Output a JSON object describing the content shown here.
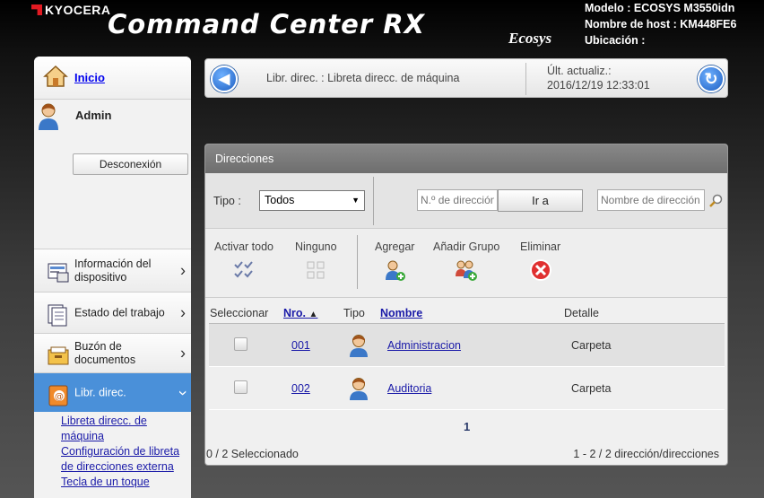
{
  "header": {
    "brand": "KYOCERA",
    "app_title": "Command Center RX",
    "ecosys": "Ecosys",
    "device_info": {
      "model": "Modelo : ECOSYS M3550idn",
      "host": "Nombre de host : KM448FE6",
      "location": "Ubicación :"
    }
  },
  "sidebar": {
    "home_label": "Inicio",
    "user_name": "Admin",
    "logout_label": "Desconexión",
    "items": [
      {
        "label": "Información del dispositivo",
        "icon": "device-info-icon"
      },
      {
        "label": "Estado del trabajo",
        "icon": "job-status-icon"
      },
      {
        "label": "Buzón de documentos",
        "icon": "document-box-icon"
      },
      {
        "label": "Libr. direc.",
        "icon": "address-book-icon",
        "active": true
      }
    ],
    "sub_links": [
      "Libreta direcc. de máquina",
      "Configuración de libreta de direcciones externa",
      "Tecla de un toque"
    ]
  },
  "topbar": {
    "breadcrumb": "Libr. direc. : Libreta direcc. de máquina",
    "updated_label": "Últ. actualiz.:",
    "updated_value": "2016/12/19 12:33:01"
  },
  "panel": {
    "title": "Direcciones",
    "filter": {
      "type_label": "Tipo :",
      "type_value": "Todos",
      "number_placeholder": "N.º de dirección",
      "go_label": "Ir a",
      "name_placeholder": "Nombre de dirección"
    },
    "actions": {
      "select_all": "Activar todo",
      "none": "Ninguno",
      "add": "Agregar",
      "add_group": "Añadir Grupo",
      "delete": "Eliminar"
    },
    "table": {
      "headers": {
        "select": "Seleccionar",
        "number": "Nro.",
        "type": "Tipo",
        "name": "Nombre",
        "detail": "Detalle"
      },
      "rows": [
        {
          "number": "001",
          "name": "Administracion",
          "detail": "Carpeta"
        },
        {
          "number": "002",
          "name": "Auditoria",
          "detail": "Carpeta"
        }
      ]
    },
    "page": "1",
    "selected_count": "0 / 2 Seleccionado",
    "range": "1 - 2 / 2 dirección/direcciones"
  },
  "colors": {
    "accent": "#4a90d9",
    "link": "#1a1aa8",
    "delete": "#e03030"
  }
}
